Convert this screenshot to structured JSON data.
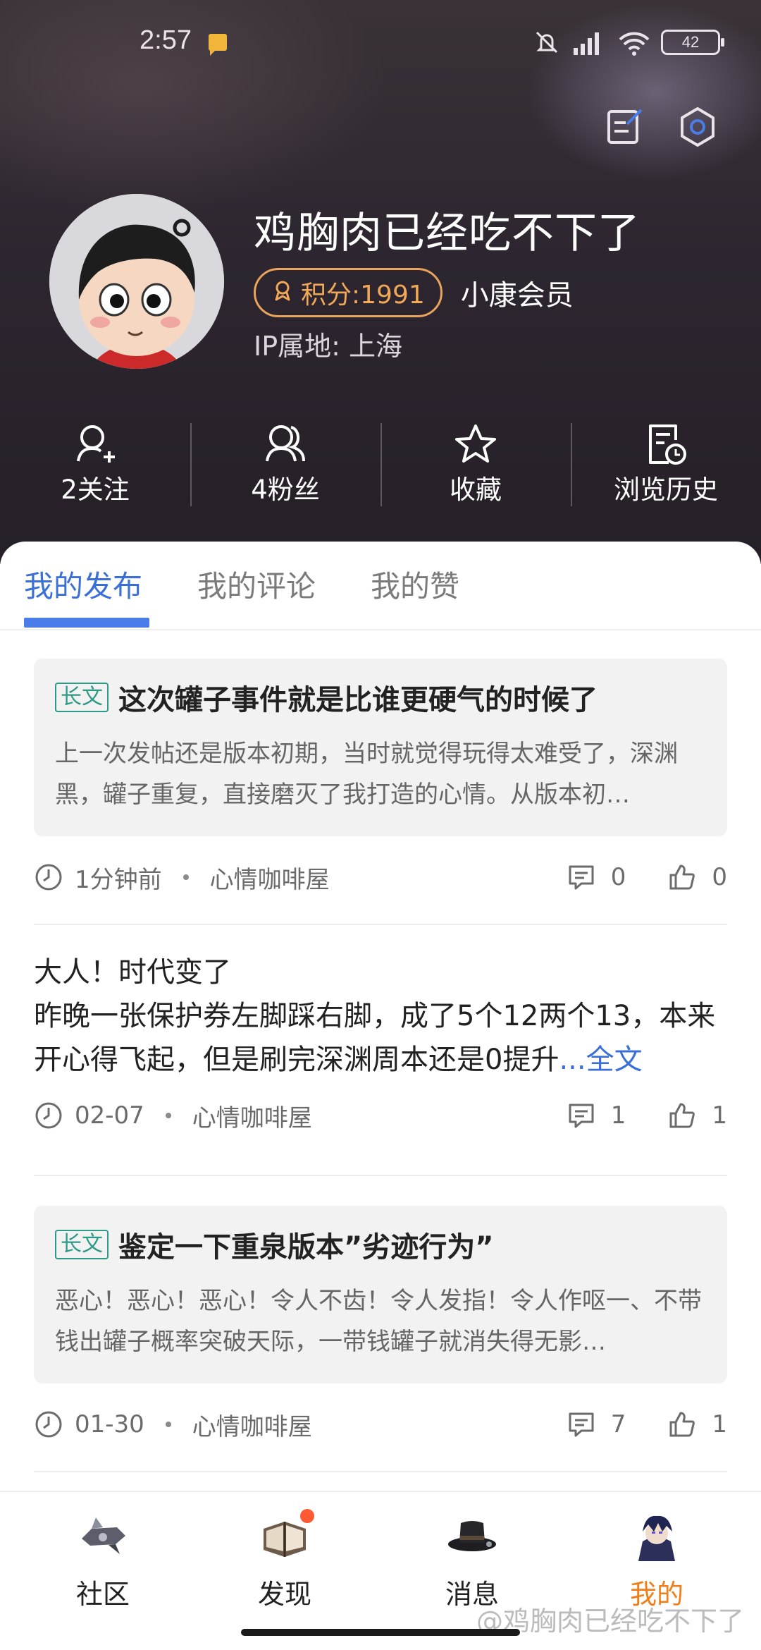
{
  "status_bar": {
    "time": "2:57",
    "battery": "42"
  },
  "profile": {
    "username": "鸡胸肉已经吃不下了",
    "points_label": "积分:1991",
    "member_label": "小康会员",
    "ip_label": "IP属地: 上海"
  },
  "stats": [
    {
      "label": "2关注",
      "icon": "follow-icon"
    },
    {
      "label": "4粉丝",
      "icon": "fans-icon"
    },
    {
      "label": "收藏",
      "icon": "star-icon"
    },
    {
      "label": "浏览历史",
      "icon": "history-icon"
    }
  ],
  "tabs": [
    {
      "label": "我的发布",
      "active": true
    },
    {
      "label": "我的评论",
      "active": false
    },
    {
      "label": "我的赞",
      "active": false
    }
  ],
  "posts": [
    {
      "tag": "长文",
      "title": "这次罐子事件就是比谁更硬气的时候了",
      "excerpt": "上一次发帖还是版本初期，当时就觉得玩得太难受了，深渊黑，罐子重复，直接磨灭了我打造的心情。从版本初…",
      "time": "1分钟前",
      "board": "心情咖啡屋",
      "comments": "0",
      "likes": "0"
    },
    {
      "title": "大人！时代变了",
      "body": "昨晚一张保护券左脚踩右脚，成了5个12两个13，本来开心得飞起，但是刷完深渊周本还是0提升",
      "more": "...全文",
      "time": "02-07",
      "board": "心情咖啡屋",
      "comments": "1",
      "likes": "1"
    },
    {
      "tag": "长文",
      "title": "鉴定一下重泉版本”劣迹行为”",
      "excerpt": "恶心！恶心！恶心！令人不齿！令人发指！令人作呕一、不带钱出罐子概率突破天际，一带钱罐子就消失得无影…",
      "time": "01-30",
      "board": "心情咖啡屋",
      "comments": "7",
      "likes": "1"
    }
  ],
  "bottom_nav": [
    {
      "label": "社区",
      "icon": "community-icon"
    },
    {
      "label": "发现",
      "icon": "discover-icon"
    },
    {
      "label": "消息",
      "icon": "message-icon"
    },
    {
      "label": "我的",
      "icon": "profile-icon",
      "active": true
    }
  ],
  "watermark": "@鸡胸肉已经吃不下了",
  "colors": {
    "accent_blue": "#4a7de8",
    "points_orange": "#f1a957",
    "active_nav": "#ef7f1a",
    "tag_green": "#2d9a86"
  }
}
